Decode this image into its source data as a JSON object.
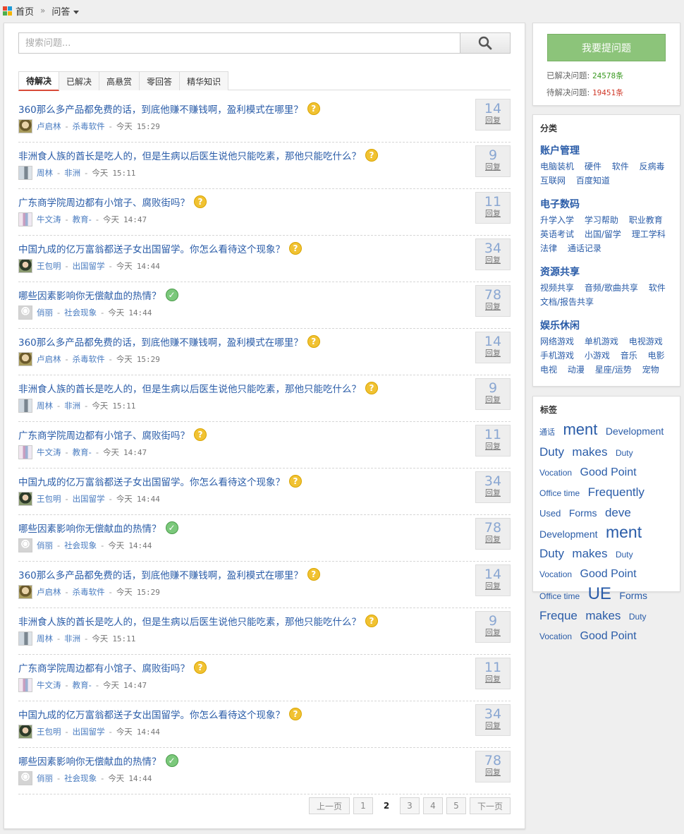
{
  "breadcrumb": {
    "home": "首页",
    "separator": "»",
    "current": "问答"
  },
  "search": {
    "placeholder": "搜索问题..."
  },
  "tabs": [
    {
      "label": "待解决",
      "active": true
    },
    {
      "label": "已解决",
      "active": false
    },
    {
      "label": "高悬赏",
      "active": false
    },
    {
      "label": "零回答",
      "active": false
    },
    {
      "label": "精华知识",
      "active": false
    }
  ],
  "meta_sep": "-",
  "reply_label": "回复",
  "questions": [
    {
      "title": "360那么多产品都免费的话，到底他赚不赚钱啊，盈利模式在哪里？",
      "status": "pending",
      "user": "卢启林",
      "category": "杀毒软件",
      "date": "今天",
      "time": "15:29",
      "replies": "14",
      "avatar": "a"
    },
    {
      "title": "非洲食人族的酋长是吃人的，但是生病以后医生说他只能吃素，那他只能吃什么？",
      "status": "pending",
      "user": "周林",
      "category": "非洲",
      "date": "今天",
      "time": "15:11",
      "replies": "9",
      "avatar": "b"
    },
    {
      "title": "广东商学院周边都有小馆子、腐败街吗？",
      "status": "pending",
      "user": "牛文涛",
      "category": "教育-",
      "date": "今天",
      "time": "14:47",
      "replies": "11",
      "avatar": "c"
    },
    {
      "title": "中国九成的亿万富翁都送子女出国留学。你怎么看待这个现象？",
      "status": "pending",
      "user": "王包明",
      "category": "出国留学",
      "date": "今天",
      "time": "14:44",
      "replies": "34",
      "avatar": "d"
    },
    {
      "title": "哪些因素影响你无偿献血的热情？",
      "status": "solved",
      "user": "俏丽",
      "category": "社会现象",
      "date": "今天",
      "time": "14:44",
      "replies": "78",
      "avatar": "e"
    },
    {
      "title": "360那么多产品都免费的话，到底他赚不赚钱啊，盈利模式在哪里？",
      "status": "pending",
      "user": "卢启林",
      "category": "杀毒软件",
      "date": "今天",
      "time": "15:29",
      "replies": "14",
      "avatar": "a"
    },
    {
      "title": "非洲食人族的酋长是吃人的，但是生病以后医生说他只能吃素，那他只能吃什么？",
      "status": "pending",
      "user": "周林",
      "category": "非洲",
      "date": "今天",
      "time": "15:11",
      "replies": "9",
      "avatar": "b"
    },
    {
      "title": "广东商学院周边都有小馆子、腐败街吗？",
      "status": "pending",
      "user": "牛文涛",
      "category": "教育-",
      "date": "今天",
      "time": "14:47",
      "replies": "11",
      "avatar": "c"
    },
    {
      "title": "中国九成的亿万富翁都送子女出国留学。你怎么看待这个现象？",
      "status": "pending",
      "user": "王包明",
      "category": "出国留学",
      "date": "今天",
      "time": "14:44",
      "replies": "34",
      "avatar": "d"
    },
    {
      "title": "哪些因素影响你无偿献血的热情？",
      "status": "solved",
      "user": "俏丽",
      "category": "社会现象",
      "date": "今天",
      "time": "14:44",
      "replies": "78",
      "avatar": "e"
    },
    {
      "title": "360那么多产品都免费的话，到底他赚不赚钱啊，盈利模式在哪里？",
      "status": "pending",
      "user": "卢启林",
      "category": "杀毒软件",
      "date": "今天",
      "time": "15:29",
      "replies": "14",
      "avatar": "a"
    },
    {
      "title": "非洲食人族的酋长是吃人的，但是生病以后医生说他只能吃素，那他只能吃什么？",
      "status": "pending",
      "user": "周林",
      "category": "非洲",
      "date": "今天",
      "time": "15:11",
      "replies": "9",
      "avatar": "b"
    },
    {
      "title": "广东商学院周边都有小馆子、腐败街吗？",
      "status": "pending",
      "user": "牛文涛",
      "category": "教育-",
      "date": "今天",
      "time": "14:47",
      "replies": "11",
      "avatar": "c"
    },
    {
      "title": "中国九成的亿万富翁都送子女出国留学。你怎么看待这个现象？",
      "status": "pending",
      "user": "王包明",
      "category": "出国留学",
      "date": "今天",
      "time": "14:44",
      "replies": "34",
      "avatar": "d"
    },
    {
      "title": "哪些因素影响你无偿献血的热情？",
      "status": "solved",
      "user": "俏丽",
      "category": "社会现象",
      "date": "今天",
      "time": "14:44",
      "replies": "78",
      "avatar": "e"
    }
  ],
  "pager": {
    "prev": "上一页",
    "next": "下一页",
    "pages": [
      "1",
      "2",
      "3",
      "4",
      "5"
    ],
    "current": "2"
  },
  "sidebar": {
    "ask_button": "我要提问题",
    "solved_label": "已解决问题:",
    "solved_count": "24578条",
    "pending_label": "待解决问题:",
    "pending_count": "19451条",
    "category_title": "分类",
    "categories": [
      {
        "name": "账户管理",
        "items": [
          "电脑装机",
          "硬件",
          "软件",
          "反病毒",
          "互联网",
          "百度知道"
        ]
      },
      {
        "name": "电子数码",
        "items": [
          "升学入学",
          "学习帮助",
          "职业教育",
          "英语考试",
          "出国/留学",
          "理工学科",
          "法律",
          "通话记录"
        ]
      },
      {
        "name": "资源共享",
        "items": [
          "视频共享",
          "音频/歌曲共享",
          "软件",
          "文档/报告共享"
        ]
      },
      {
        "name": "娱乐休闲",
        "items": [
          "网络游戏",
          "单机游戏",
          "电视游戏",
          "手机游戏",
          "小游戏",
          "音乐",
          "电影",
          "电视",
          "动漫",
          "星座/运势",
          "宠物"
        ]
      }
    ],
    "tag_title": "标签",
    "tags": [
      {
        "text": "通话",
        "size": "t11"
      },
      {
        "text": "ment",
        "size": "t22"
      },
      {
        "text": "Development",
        "size": "t14"
      },
      {
        "text": "Duty",
        "size": "t17"
      },
      {
        "text": "makes",
        "size": "t17"
      },
      {
        "text": "Duty",
        "size": "t12"
      },
      {
        "text": "Vocation",
        "size": "t12"
      },
      {
        "text": "Good Point",
        "size": "t16"
      },
      {
        "text": "Office time",
        "size": "t12"
      },
      {
        "text": "Frequently",
        "size": "t17"
      },
      {
        "text": "Used",
        "size": "t13"
      },
      {
        "text": "Forms",
        "size": "t14"
      },
      {
        "text": "deve",
        "size": "t17"
      },
      {
        "text": "Development",
        "size": "t14"
      },
      {
        "text": "ment",
        "size": "t23"
      },
      {
        "text": "Duty",
        "size": "t17"
      },
      {
        "text": "makes",
        "size": "t17"
      },
      {
        "text": "Duty",
        "size": "t12"
      },
      {
        "text": "Vocation",
        "size": "t12"
      },
      {
        "text": "Good Point",
        "size": "t16"
      },
      {
        "text": "Office time",
        "size": "t12"
      },
      {
        "text": "UE",
        "size": "t24"
      },
      {
        "text": "Forms",
        "size": "t14"
      },
      {
        "text": "Freque",
        "size": "t17"
      },
      {
        "text": "makes",
        "size": "t17"
      },
      {
        "text": "Duty",
        "size": "t12"
      },
      {
        "text": "Vocation",
        "size": "t12"
      },
      {
        "text": "Good Point",
        "size": "t16"
      }
    ]
  },
  "colors": {
    "link": "#2a5ca8",
    "accent_red": "#d84a38",
    "ask_button": "#8cc47a",
    "solved_green": "#3a9a22",
    "pending_red": "#d03a2a"
  }
}
